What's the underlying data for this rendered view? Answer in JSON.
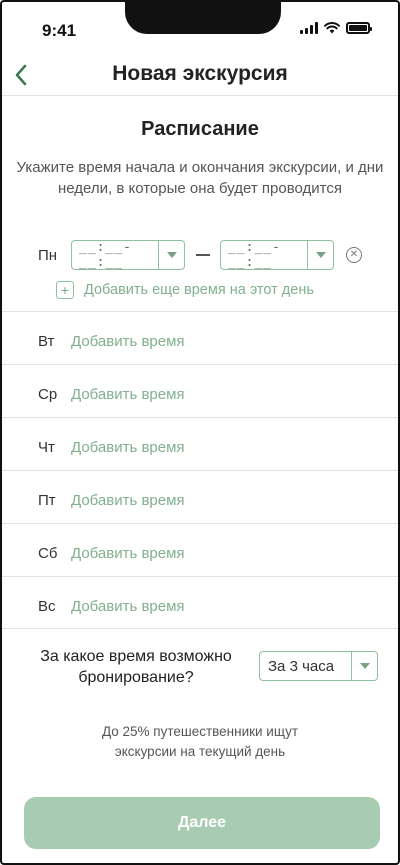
{
  "status_bar": {
    "time": "9:41"
  },
  "header": {
    "title": "Новая экскурсия",
    "back_icon": "chevron-left-icon"
  },
  "schedule": {
    "title": "Расписание",
    "description": "Укажите время начала и окончания экскурсии, и дни недели, в которые она будет проводится",
    "monday": {
      "label": "Пн",
      "start_placeholder": "__:__-__:__",
      "end_placeholder": "__:__-__:__",
      "add_more_label": "Добавить еще время на этот день"
    },
    "days": [
      {
        "label": "Вт",
        "action": "Добавить время"
      },
      {
        "label": "Ср",
        "action": "Добавить время"
      },
      {
        "label": "Чт",
        "action": "Добавить время"
      },
      {
        "label": "Пт",
        "action": "Добавить время"
      },
      {
        "label": "Сб",
        "action": "Добавить время"
      },
      {
        "label": "Вс",
        "action": "Добавить время"
      }
    ]
  },
  "booking": {
    "question": "За какое время возможно бронирование?",
    "selected": "За 3 часа"
  },
  "hint": {
    "line1": "До 25% путешественники ищут",
    "line2": "экскурсии на текущий день"
  },
  "next_button": {
    "label": "Далее"
  },
  "colors": {
    "accent": "#82b08f",
    "button": "#a7ccb2",
    "border": "#8fc1a0"
  }
}
